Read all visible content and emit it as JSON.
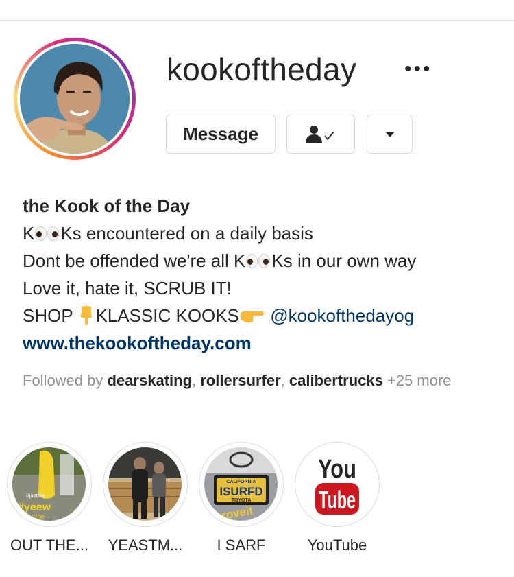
{
  "profile": {
    "username": "kookoftheday",
    "more_icon": "more-horizontal-icon",
    "message_label": "Message",
    "follow_icon": "person-check-icon",
    "dropdown_icon": "caret-down-icon",
    "bio": {
      "name": "the Kook of the Day",
      "line1_pre": "K",
      "line1_post": "Ks encountered on a daily basis",
      "line2_pre": "Dont be offended we're all K",
      "line2_post": "Ks in our own way",
      "line3": "Love it, hate it, SCRUB IT!",
      "line4_a": "SHOP ",
      "line4_b": "KLASSIC KOOKS",
      "mention": "@kookofthedayog",
      "website": "www.thekookoftheday.com"
    },
    "followed_by": {
      "prefix": "Followed by ",
      "users": [
        "dearskating",
        "rollersurfer",
        "calibertrucks"
      ],
      "suffix": " +25 more"
    }
  },
  "highlights": [
    {
      "label": "OUT THE...",
      "image_text": [
        "#justthe",
        "#yeew",
        "#outthe"
      ]
    },
    {
      "label": "YEASTM..."
    },
    {
      "label": "I SARF",
      "plate_top": "CALIFORNIA",
      "plate_main": "ISURFD",
      "plate_bottom": "TOYOTA",
      "overlay": "proveit"
    },
    {
      "label": "YouTube",
      "logo_top": "You",
      "logo_bottom": "Tube"
    }
  ],
  "colors": {
    "link": "#003569",
    "text": "#262626",
    "muted": "#8e8e8e",
    "border": "#dbdbdb",
    "youtube_red": "#cc181e"
  }
}
